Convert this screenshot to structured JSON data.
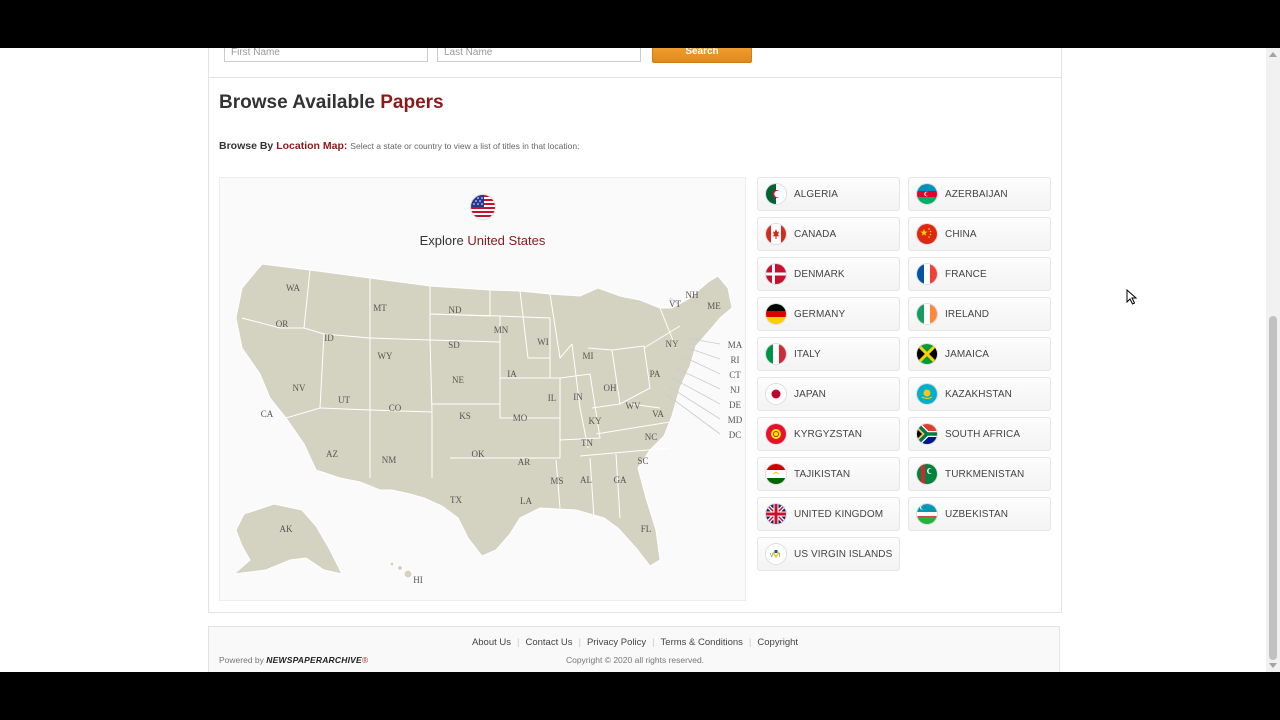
{
  "search": {
    "first_name_placeholder": "First Name",
    "last_name_placeholder": "Last Name",
    "button_label": "Search"
  },
  "browse": {
    "title_prefix": "Browse Available",
    "title_accent": "Papers",
    "by_label": "Browse By",
    "by_link": "Location Map:",
    "hint": "Select a state or country to view a list of titles in that location:"
  },
  "map": {
    "explore_prefix": "Explore",
    "explore_country": "United States",
    "states": {
      "WA": "WA",
      "OR": "OR",
      "CA": "CA",
      "ID": "ID",
      "NV": "NV",
      "MT": "MT",
      "WY": "WY",
      "UT": "UT",
      "AZ": "AZ",
      "CO": "CO",
      "NM": "NM",
      "ND": "ND",
      "SD": "SD",
      "NE": "NE",
      "KS": "KS",
      "OK": "OK",
      "TX": "TX",
      "MN": "MN",
      "IA": "IA",
      "MO": "MO",
      "AR": "AR",
      "LA": "LA",
      "WI": "WI",
      "IL": "IL",
      "MI": "MI",
      "IN": "IN",
      "OH": "OH",
      "KY": "KY",
      "TN": "TN",
      "MS": "MS",
      "AL": "AL",
      "GA": "GA",
      "FL": "FL",
      "SC": "SC",
      "NC": "NC",
      "VA": "VA",
      "WV": "WV",
      "PA": "PA",
      "NY": "NY",
      "VT": "VT",
      "NH": "NH",
      "ME": "ME",
      "MA": "MA",
      "RI": "RI",
      "CT": "CT",
      "NJ": "NJ",
      "DE": "DE",
      "MD": "MD",
      "DC": "DC",
      "AK": "AK",
      "HI": "HI"
    }
  },
  "countries": [
    {
      "name": "ALGERIA",
      "flag": "algeria-flag-icon"
    },
    {
      "name": "AZERBAIJAN",
      "flag": "azerbaijan-flag-icon"
    },
    {
      "name": "CANADA",
      "flag": "canada-flag-icon"
    },
    {
      "name": "CHINA",
      "flag": "china-flag-icon"
    },
    {
      "name": "DENMARK",
      "flag": "denmark-flag-icon"
    },
    {
      "name": "FRANCE",
      "flag": "france-flag-icon"
    },
    {
      "name": "GERMANY",
      "flag": "germany-flag-icon"
    },
    {
      "name": "IRELAND",
      "flag": "ireland-flag-icon"
    },
    {
      "name": "ITALY",
      "flag": "italy-flag-icon"
    },
    {
      "name": "JAMAICA",
      "flag": "jamaica-flag-icon"
    },
    {
      "name": "JAPAN",
      "flag": "japan-flag-icon"
    },
    {
      "name": "KAZAKHSTAN",
      "flag": "kazakhstan-flag-icon"
    },
    {
      "name": "KYRGYZSTAN",
      "flag": "kyrgyzstan-flag-icon"
    },
    {
      "name": "SOUTH AFRICA",
      "flag": "south-africa-flag-icon"
    },
    {
      "name": "TAJIKISTAN",
      "flag": "tajikistan-flag-icon"
    },
    {
      "name": "TURKMENISTAN",
      "flag": "turkmenistan-flag-icon"
    },
    {
      "name": "UNITED KINGDOM",
      "flag": "united-kingdom-flag-icon"
    },
    {
      "name": "UZBEKISTAN",
      "flag": "uzbekistan-flag-icon"
    },
    {
      "name": "US VIRGIN ISLANDS",
      "flag": "us-virgin-islands-flag-icon"
    }
  ],
  "footer": {
    "links": [
      "About Us",
      "Contact Us",
      "Privacy Policy",
      "Terms & Conditions",
      "Copyright"
    ],
    "copyright": "Copyright © 2020 all rights reserved.",
    "powered_by": "Powered by",
    "brand": "NEWSPAPERARCHIVE",
    "brand_mark": "®"
  },
  "colors": {
    "accent": "#8b1a1a",
    "button": "#e8921f",
    "map_fill": "#d4d2c0",
    "map_stroke": "#ffffff"
  }
}
